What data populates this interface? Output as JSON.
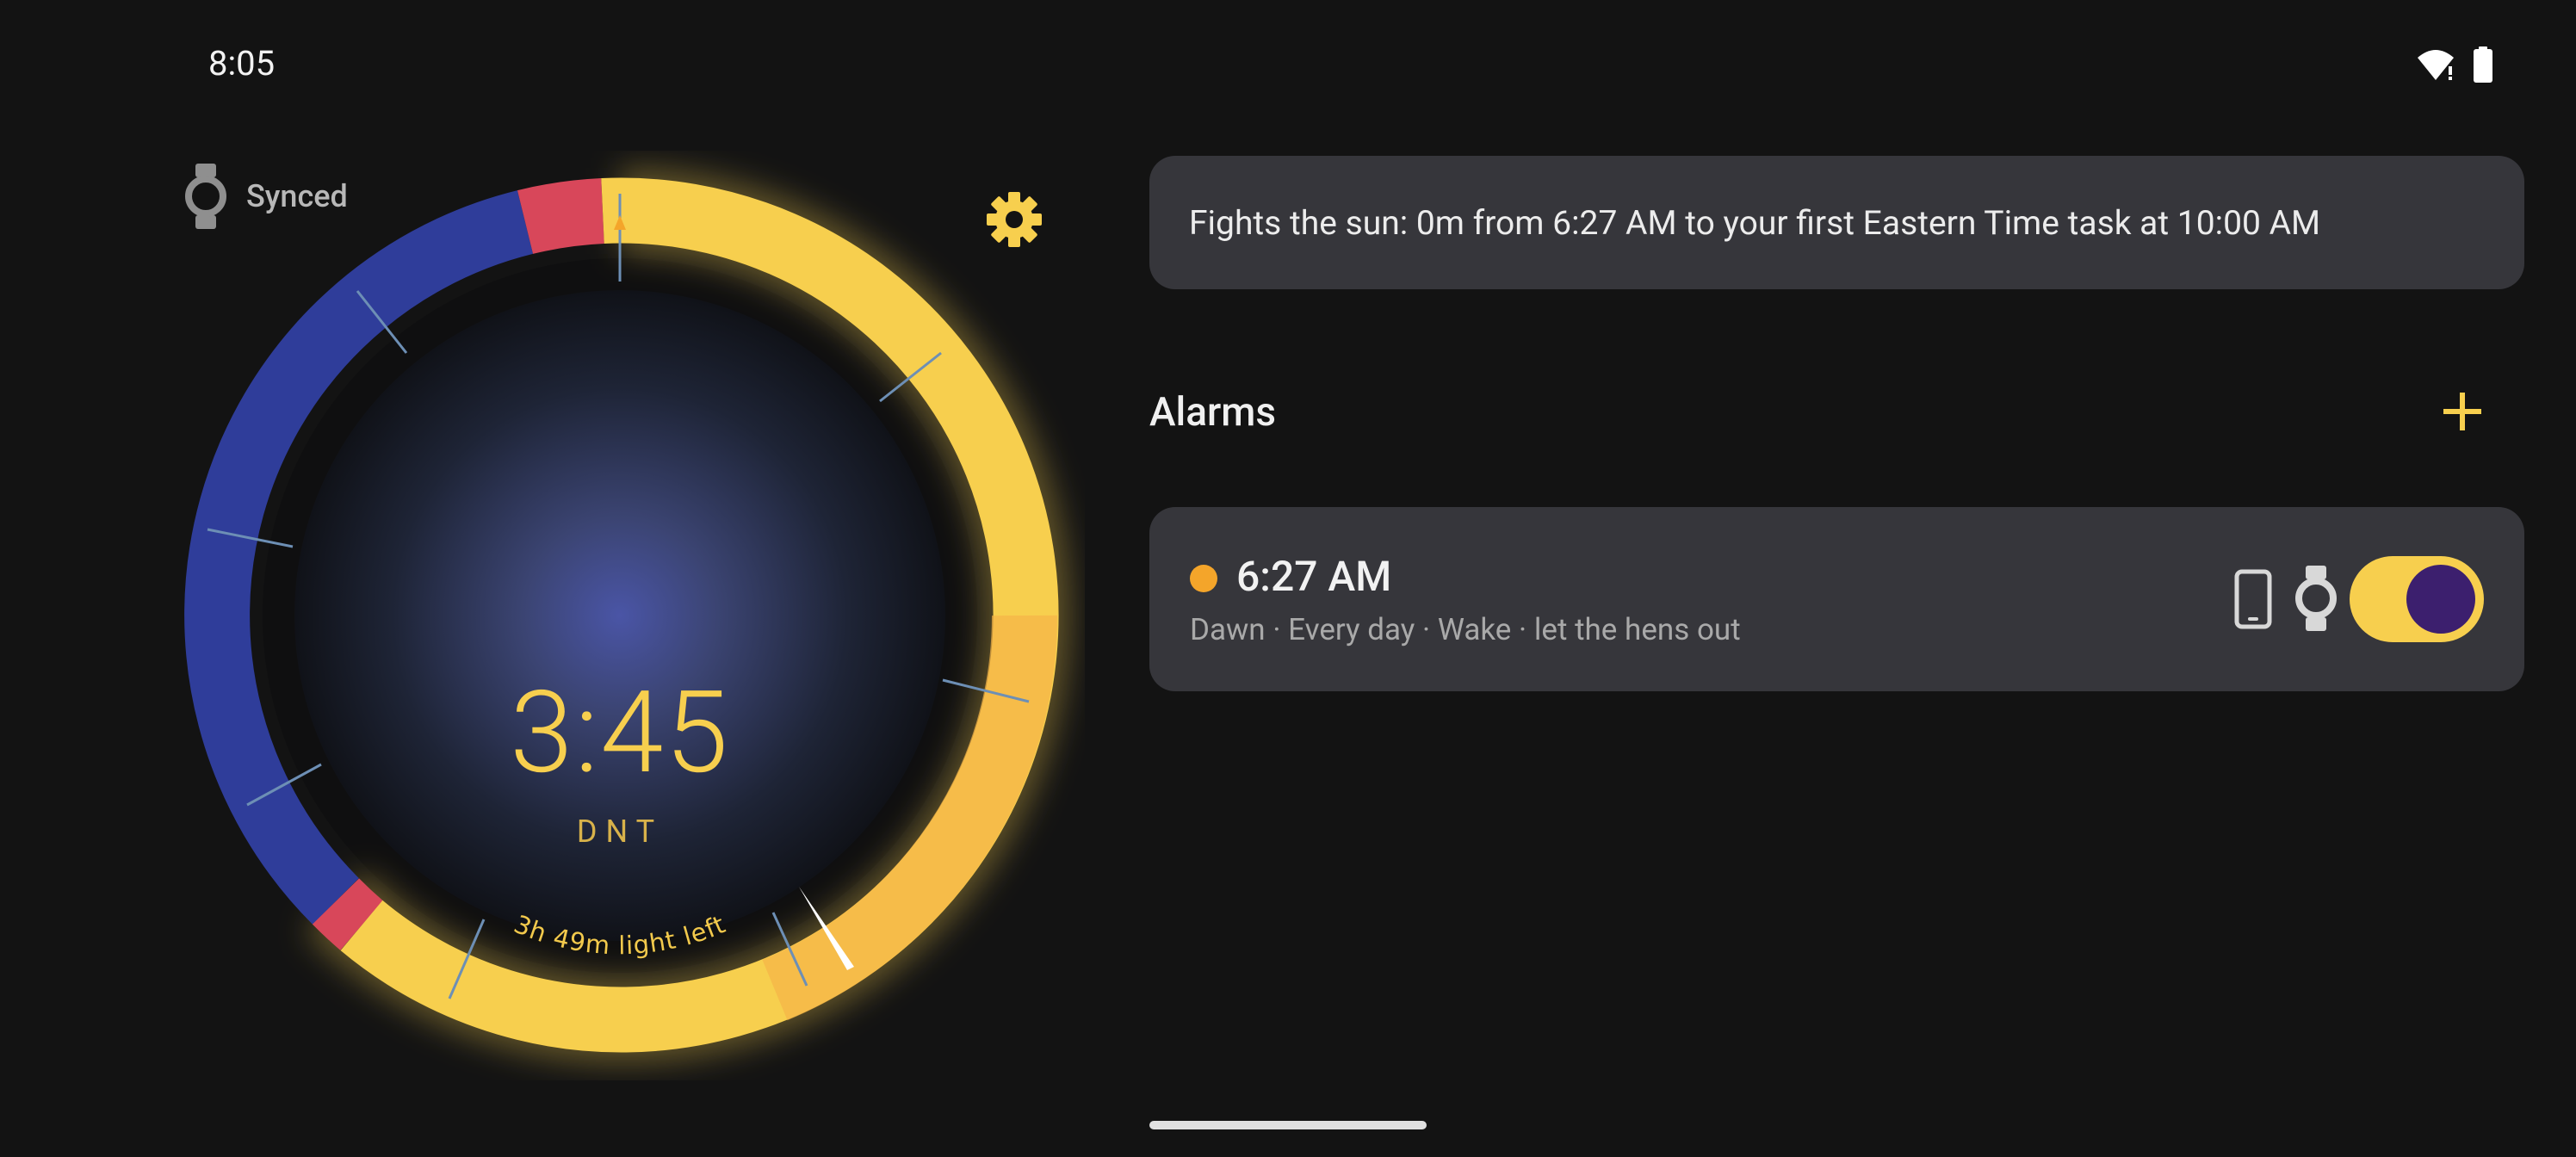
{
  "status": {
    "time": "8:05"
  },
  "sync": {
    "label": "Synced"
  },
  "clock": {
    "time": "3:45",
    "zone": "DNT",
    "light_left": "3h 49m light left"
  },
  "info": {
    "text": "Fights the sun: 0m from 6:27 AM to your first Eastern Time task at 10:00 AM"
  },
  "alarms": {
    "title": "Alarms",
    "items": [
      {
        "time": "6:27 AM",
        "description": "Dawn · Every day · Wake · let the hens out",
        "enabled": true
      }
    ]
  },
  "colors": {
    "accent": "#f7cf4e",
    "night": "#2f3d9a",
    "card": "#36363b",
    "background": "#131313",
    "alarm_dot": "#f4a52a"
  }
}
